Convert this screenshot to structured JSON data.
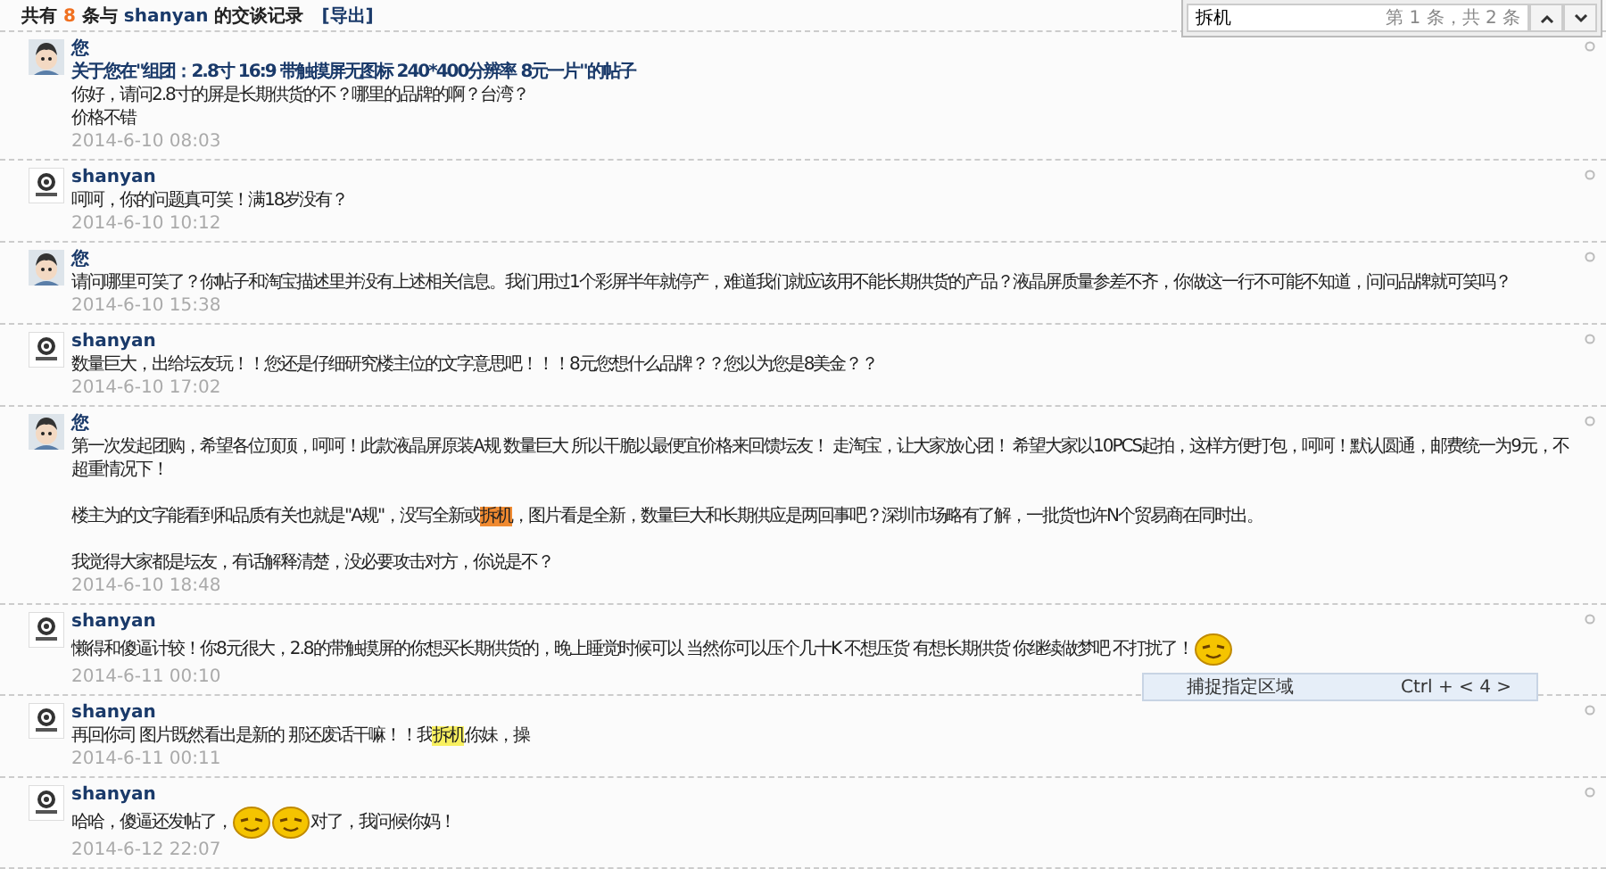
{
  "header": {
    "prefix": "共有",
    "count": "8",
    "middle": "条与",
    "user": "shanyan",
    "suffix": "的交谈记录",
    "export_link": "[导出]"
  },
  "find_bar": {
    "value": "拆机",
    "counter": "第 1 条，共 2 条"
  },
  "messages": [
    {
      "author": "您",
      "kind": "you",
      "title": "关于您在\"组团：2.8寸 16:9 带触摸屏无图标 240*400分辨率 8元一片\"的帖子",
      "paragraphs": [
        {
          "lines": [
            {
              "parts": [
                {
                  "kind": "text",
                  "text": "你好，请问2.8寸的屏是长期供货的不？哪里的品牌的啊？台湾？"
                }
              ]
            },
            {
              "parts": [
                {
                  "kind": "text",
                  "text": "价格不错"
                }
              ]
            }
          ]
        }
      ],
      "time": "2014-6-10 08:03"
    },
    {
      "author": "shanyan",
      "kind": "logo",
      "paragraphs": [
        {
          "lines": [
            {
              "parts": [
                {
                  "kind": "text",
                  "text": "呵呵，你的问题真可笑！满18岁没有？"
                }
              ]
            }
          ]
        }
      ],
      "time": "2014-6-10 10:12"
    },
    {
      "author": "您",
      "kind": "you",
      "paragraphs": [
        {
          "lines": [
            {
              "parts": [
                {
                  "kind": "text",
                  "text": "请问哪里可笑了？你帖子和淘宝描述里并没有上述相关信息。我们用过1个彩屏半年就停产，难道我们就应该用不能长期供货的产品？液晶屏质量参差不齐，你做这一行不可能不知道，问问品牌就可笑吗？"
                }
              ]
            }
          ]
        }
      ],
      "time": "2014-6-10 15:38"
    },
    {
      "author": "shanyan",
      "kind": "logo",
      "paragraphs": [
        {
          "lines": [
            {
              "parts": [
                {
                  "kind": "text",
                  "text": "数量巨大，出给坛友玩！！您还是仔细研究楼主位的文字意思吧！！！8元您想什么品牌？？您以为您是8美金？？"
                }
              ]
            }
          ]
        }
      ],
      "time": "2014-6-10 17:02"
    },
    {
      "author": "您",
      "kind": "you",
      "paragraphs": [
        {
          "lines": [
            {
              "parts": [
                {
                  "kind": "text",
                  "text": "第一次发起团购，希望各位顶顶，呵呵！此款液晶屏原装A规  数量巨大  所以干脆以最便宜价格来回馈坛友！ 走淘宝，让大家放心团！  希望大家以10PCS起拍，这样方便打包，呵呵！默认圆通，邮费统一为9元，不超重情况下！"
                }
              ]
            }
          ]
        },
        {
          "lines": [
            {
              "parts": [
                {
                  "kind": "text",
                  "text": "楼主为的文字能看到和品质有关也就是\"A规\"，没写全新或"
                },
                {
                  "kind": "match",
                  "text": "拆机",
                  "selected": true
                },
                {
                  "kind": "text",
                  "text": "，图片看是全新，数量巨大和长期供应是两回事吧？深圳市场略有了解，一批货也许N个贸易商在同时出。"
                }
              ]
            }
          ]
        },
        {
          "lines": [
            {
              "parts": [
                {
                  "kind": "text",
                  "text": "我觉得大家都是坛友，有话解释清楚，没必要攻击对方，你说是不？"
                }
              ]
            }
          ]
        }
      ],
      "time": "2014-6-10 18:48"
    },
    {
      "author": "shanyan",
      "kind": "logo",
      "paragraphs": [
        {
          "lines": [
            {
              "parts": [
                {
                  "kind": "text",
                  "text": "懒得和傻逼计较！你8元很大，2.8的带触摸屏的你想买长期供货的，晚上睡觉时候可以  当然你可以压个几十K   不想压货 有想长期供货  你继续做梦吧  不打扰了！"
                },
                {
                  "kind": "emoticon"
                }
              ]
            }
          ]
        }
      ],
      "time": "2014-6-11 00:10"
    },
    {
      "author": "shanyan",
      "kind": "logo",
      "paragraphs": [
        {
          "lines": [
            {
              "parts": [
                {
                  "kind": "text",
                  "text": "再回你司 图片既然看出是新的 那还废话干嘛！！我"
                },
                {
                  "kind": "match",
                  "text": "拆机",
                  "selected": false
                },
                {
                  "kind": "text",
                  "text": "你妹，操"
                }
              ]
            }
          ]
        }
      ],
      "time": "2014-6-11 00:11"
    },
    {
      "author": "shanyan",
      "kind": "logo",
      "paragraphs": [
        {
          "lines": [
            {
              "parts": [
                {
                  "kind": "text",
                  "text": "哈哈，傻逼还发帖了，"
                },
                {
                  "kind": "emoticon"
                },
                {
                  "kind": "emoticon"
                },
                {
                  "kind": "text",
                  "text": "对了，我问候你妈！"
                }
              ]
            }
          ]
        }
      ],
      "time": "2014-6-12 22:07"
    }
  ],
  "context_menu": {
    "label": "捕捉指定区域",
    "shortcut": "Ctrl + < 4 >"
  }
}
